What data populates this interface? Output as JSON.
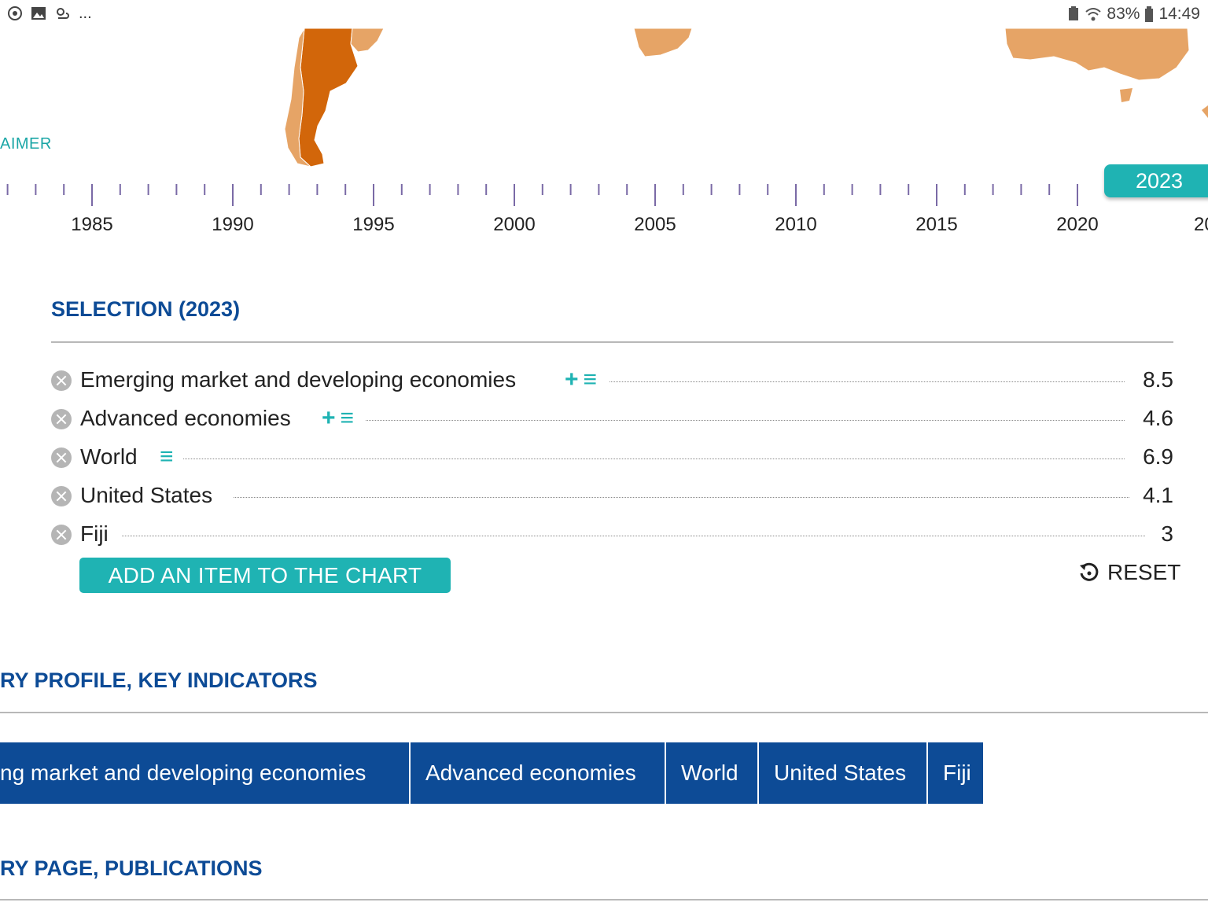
{
  "status_bar": {
    "left_icons": [
      "sync-icon",
      "image-icon",
      "weather-icon"
    ],
    "overflow": "...",
    "battery": "83%",
    "time": "14:49"
  },
  "map": {
    "disclaimer_label": "AIMER",
    "colors": {
      "dark": "#d2660a",
      "light": "#e6a466"
    }
  },
  "timeline": {
    "years": [
      "1985",
      "1990",
      "1995",
      "2000",
      "2005",
      "2010",
      "2015",
      "2020",
      "20"
    ],
    "selected_year": "2023"
  },
  "selection": {
    "title": "SELECTION (2023)",
    "rows": [
      {
        "label": "Emerging market and developing economies",
        "value": "8.5",
        "tools": [
          "+",
          "≡"
        ]
      },
      {
        "label": "Advanced economies",
        "value": "4.6",
        "tools": [
          "+",
          "≡"
        ]
      },
      {
        "label": "World",
        "value": "6.9",
        "tools": [
          "≡"
        ]
      },
      {
        "label": "United States",
        "value": "4.1",
        "tools": []
      },
      {
        "label": "Fiji",
        "value": "3",
        "tools": []
      }
    ],
    "add_button": "ADD AN ITEM TO THE CHART",
    "reset_label": "RESET"
  },
  "sections": {
    "profile_title": "RY PROFILE, KEY INDICATORS",
    "tabs": [
      "ng market and developing economies",
      "Advanced economies",
      "World",
      "United States",
      "Fiji"
    ],
    "publications_title": "RY PAGE, PUBLICATIONS"
  },
  "colors": {
    "accent": "#1fb3b3",
    "brand": "#0d4b96"
  }
}
